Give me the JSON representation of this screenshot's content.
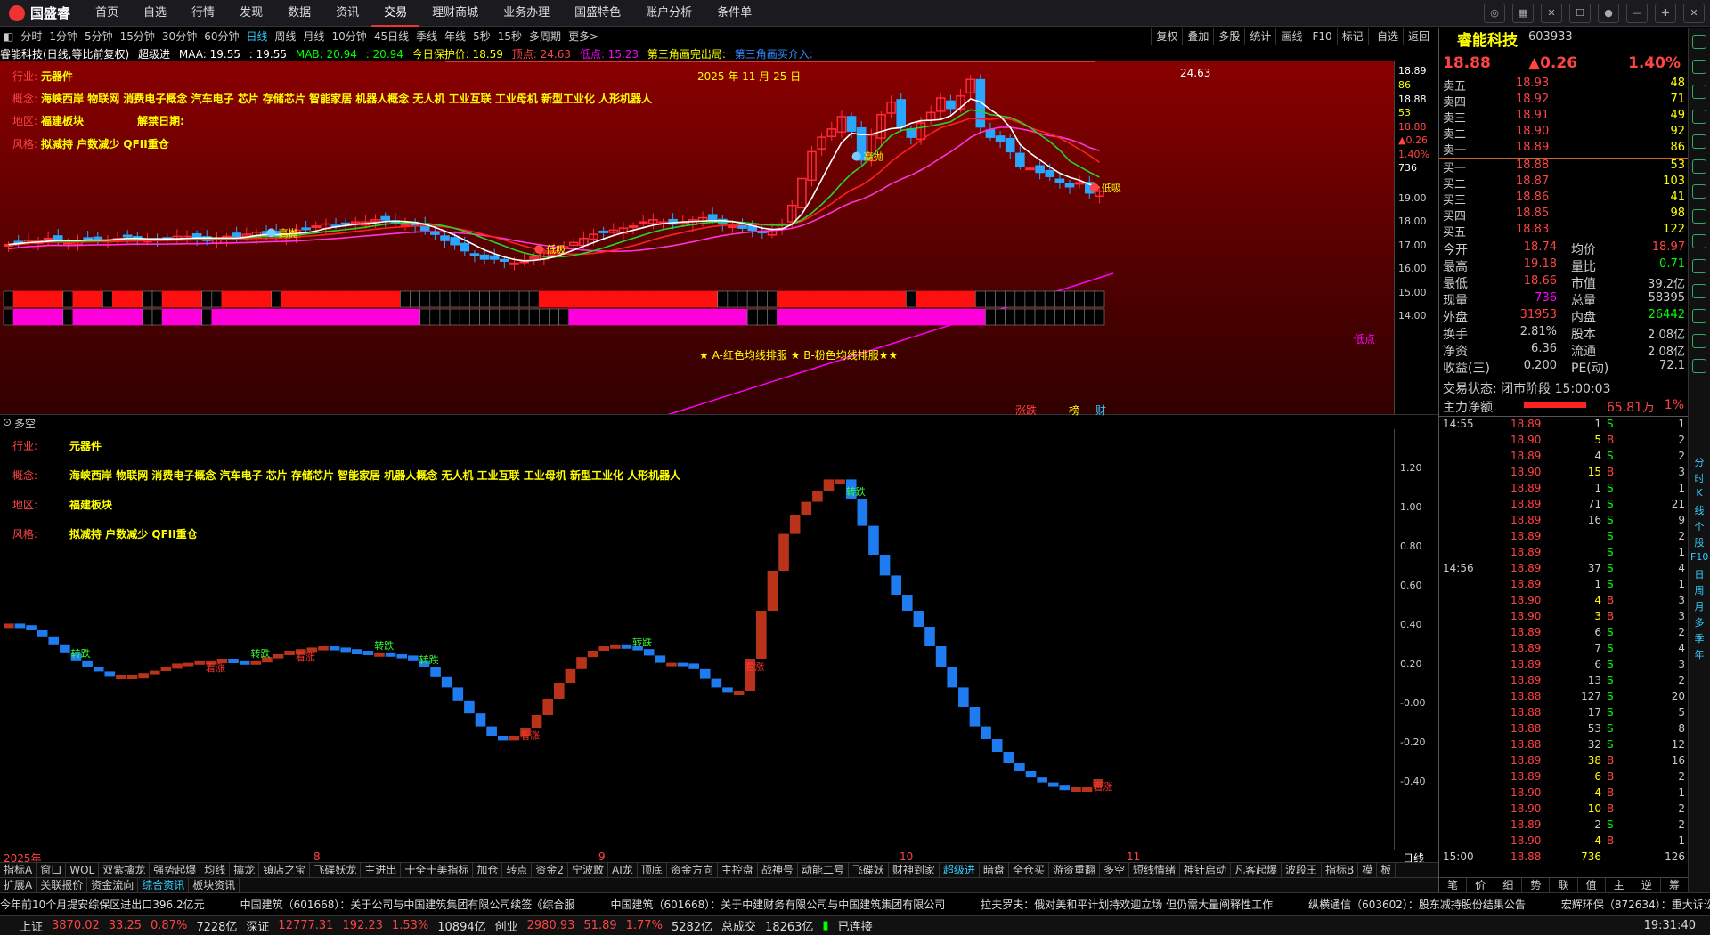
{
  "app": {
    "logo": "国盛睿",
    "menu": [
      "首页",
      "自选",
      "行情",
      "发现",
      "数据",
      "资讯",
      "交易",
      "理财商城",
      "业务办理",
      "国盛特色",
      "账户分析",
      "条件单"
    ],
    "active_menu": "交易"
  },
  "periods": [
    "分时",
    "1分钟",
    "5分钟",
    "15分钟",
    "30分钟",
    "60分钟",
    "日线",
    "周线",
    "月线",
    "10分钟",
    "45日线",
    "季线",
    "年线",
    "5秒",
    "15秒",
    "多周期",
    "更多>"
  ],
  "active_period": "日线",
  "chart_tools": [
    "复权",
    "叠加",
    "多股",
    "统计",
    "画线",
    "F10",
    "标记",
    "-自选",
    "返回"
  ],
  "legend": {
    "name": "睿能科技(日线,等比前复权)",
    "indicator": "超级进",
    "maa_label": "MAA: 19.55",
    "maa_val": ": 19.55",
    "mab_label": "MAB: 20.94",
    "mab_val": ": 20.94",
    "protect": "今日保护价: 18.59",
    "top": "顶点: 24.63",
    "bottom": "低点: 15.23",
    "tri1": "第三角画完出局:",
    "tri2": "第三角画买介入:"
  },
  "info": {
    "industry_k": "行业:",
    "industry_v": "元器件",
    "concept_k": "概念:",
    "concept_v": "海峡西岸 物联网 消费电子概念 汽车电子 芯片 存储芯片 智能家居 机器人概念 无人机 工业互联 工业母机 新型工业化 人形机器人",
    "region_k": "地区:",
    "region_v": "福建板块",
    "lift_k": "解禁日期:",
    "style_k": "风格:",
    "style_v": "拟减持 户数减少 QFII重仓"
  },
  "main_date_label": "2025 年 11 月 25 日",
  "main_top_value": "24.63",
  "main_bottom_label": "低点",
  "ma_note": "★ A-红色均线排服 ★ B-粉色均线排服★★",
  "signal_labels": {
    "high": "高抛",
    "low": "低吸",
    "rise": "看涨",
    "fall": "转跌"
  },
  "main_axis": {
    "ticks": [
      "18.89",
      "86",
      "18.88",
      "53",
      "18.88",
      "▲0.26",
      "1.40%",
      "736",
      "19.00",
      "18.00",
      "17.00",
      "16.00",
      "15.00",
      "14.00"
    ]
  },
  "sub": {
    "title": "多空",
    "bottom_labels": [
      "涨跌",
      "榜",
      "财"
    ]
  },
  "sub_axis": [
    "1.20",
    "1.00",
    "0.80",
    "0.60",
    "0.40",
    "0.20",
    "-0.00",
    "-0.20",
    "-0.40"
  ],
  "dates": [
    "2025年",
    "8",
    "9",
    "10",
    "11"
  ],
  "date_right": "日线",
  "tabs1": [
    "指标A",
    "窗口",
    "WOL",
    "双紫擒龙",
    "强势起爆",
    "均线",
    "擒龙",
    "镇店之宝",
    "飞碟妖龙",
    "主进出",
    "十全十美指标",
    "加仓",
    "转点",
    "资金2",
    "宁波敢",
    "AI龙",
    "顶底",
    "资金方向",
    "主控盘",
    "战神号",
    "动能二号",
    "飞碟妖",
    "财神到家",
    "超级进",
    "暗盘",
    "全仓买",
    "游资重翻",
    "多空",
    "短线情绪",
    "神针启动",
    "凡客起爆",
    "波段王",
    "指标B",
    "模",
    "板"
  ],
  "tabs2": [
    "扩展A",
    "关联报价",
    "资金流向",
    "综合资讯",
    "板块资讯"
  ],
  "news": [
    "今年前10个月提安综保区进出口396.2亿元",
    "中国建筑（601668）：关于公司与中国建筑集团有限公司续签《综合服",
    "中国建筑（601668）：关于中建财务有限公司与中国建筑集团有限公司",
    "拉夫罗夫：俄对美和平计划持欢迎立场 但仍需大量阐释性工作",
    "纵横通信（603602）：股东减持股份结果公告",
    "宏辉环保（872634）：重大诉讼"
  ],
  "status": {
    "sh": "上证",
    "sh_v": "3870.02",
    "sh_c": "33.25",
    "sh_p": "0.87%",
    "sh_a": "7228亿",
    "sz": "深证",
    "sz_v": "12777.31",
    "sz_c": "192.23",
    "sz_p": "1.53%",
    "sz_a": "10894亿",
    "cy": "创业",
    "cy_v": "2980.93",
    "cy_c": "51.89",
    "cy_p": "1.77%",
    "cy_a": "5282亿",
    "tot": "总成交",
    "tot_v": "18263亿",
    "conn": "已连接",
    "time": "19:31:40"
  },
  "quote": {
    "name": "睿能科技",
    "code": "603933",
    "price": "18.88",
    "change": "▲0.26",
    "pct": "1.40%",
    "asks": [
      [
        "卖五",
        "18.93",
        "48"
      ],
      [
        "卖四",
        "18.92",
        "71"
      ],
      [
        "卖三",
        "18.91",
        "49"
      ],
      [
        "卖二",
        "18.90",
        "92"
      ],
      [
        "卖一",
        "18.89",
        "86"
      ]
    ],
    "bids": [
      [
        "买一",
        "18.88",
        "53"
      ],
      [
        "买二",
        "18.87",
        "103"
      ],
      [
        "买三",
        "18.86",
        "41"
      ],
      [
        "买四",
        "18.85",
        "98"
      ],
      [
        "买五",
        "18.83",
        "122"
      ]
    ],
    "stats": [
      [
        "今开",
        "18.74",
        "均价",
        "18.97"
      ],
      [
        "最高",
        "19.18",
        "量比",
        "0.71"
      ],
      [
        "最低",
        "18.66",
        "市值",
        "39.2亿"
      ],
      [
        "现量",
        "736",
        "总量",
        "58395"
      ],
      [
        "外盘",
        "31953",
        "内盘",
        "26442"
      ],
      [
        "换手",
        "2.81%",
        "股本",
        "2.08亿"
      ],
      [
        "净资",
        "6.36",
        "流通",
        "2.08亿"
      ],
      [
        "收益(三)",
        "0.200",
        "PE(动)",
        "72.1"
      ]
    ],
    "trade_state": "交易状态: 闭市阶段 15:00:03",
    "net_label": "主力净额",
    "net_value": "65.81万",
    "net_pct": "1%",
    "ticks": [
      [
        "14:55",
        "18.89",
        "1",
        "S",
        "1"
      ],
      [
        "",
        "18.90",
        "5",
        "B",
        "2"
      ],
      [
        "",
        "18.89",
        "4",
        "S",
        "2"
      ],
      [
        "",
        "18.90",
        "15",
        "B",
        "3"
      ],
      [
        "",
        "18.89",
        "1",
        "S",
        "1"
      ],
      [
        "",
        "18.89",
        "71",
        "S",
        "21"
      ],
      [
        "",
        "18.89",
        "16",
        "S",
        "9"
      ],
      [
        "",
        "18.89",
        "",
        "S",
        "2"
      ],
      [
        "",
        "18.89",
        "",
        "S",
        "1"
      ],
      [
        "14:56",
        "18.89",
        "37",
        "S",
        "4"
      ],
      [
        "",
        "18.89",
        "1",
        "S",
        "1"
      ],
      [
        "",
        "18.90",
        "4",
        "B",
        "3"
      ],
      [
        "",
        "18.90",
        "3",
        "B",
        "3"
      ],
      [
        "",
        "18.89",
        "6",
        "S",
        "2"
      ],
      [
        "",
        "18.89",
        "7",
        "S",
        "4"
      ],
      [
        "",
        "18.89",
        "6",
        "S",
        "3"
      ],
      [
        "",
        "18.89",
        "13",
        "S",
        "2"
      ],
      [
        "",
        "18.88",
        "127",
        "S",
        "20"
      ],
      [
        "",
        "18.88",
        "17",
        "S",
        "5"
      ],
      [
        "",
        "18.88",
        "53",
        "S",
        "8"
      ],
      [
        "",
        "18.88",
        "32",
        "S",
        "12"
      ],
      [
        "",
        "18.89",
        "38",
        "B",
        "16"
      ],
      [
        "",
        "18.89",
        "6",
        "B",
        "2"
      ],
      [
        "",
        "18.90",
        "4",
        "B",
        "1"
      ],
      [
        "",
        "18.90",
        "10",
        "B",
        "2"
      ],
      [
        "",
        "18.89",
        "2",
        "S",
        "2"
      ],
      [
        "",
        "18.90",
        "4",
        "B",
        "1"
      ],
      [
        "15:00",
        "18.88",
        "736",
        "",
        "126"
      ]
    ],
    "bottom_tabs": [
      "笔",
      "价",
      "细",
      "势",
      "联",
      "值",
      "主",
      "逆",
      "筹"
    ]
  },
  "side_icons": [
    "分",
    "时",
    "K",
    "线",
    "个",
    "股",
    "F10",
    "日",
    "周",
    "月",
    "多",
    "季",
    "年"
  ],
  "chart_data": {
    "type": "candlestick",
    "title": "睿能科技(日线,等比前复权)",
    "ylim": [
      14.0,
      25.0
    ],
    "top_price": 24.63,
    "low_price": 15.23,
    "last_close": 18.88,
    "series": [
      {
        "name": "MAA",
        "value": 19.55
      },
      {
        "name": "MAB",
        "value": 20.94
      }
    ],
    "x_labels": [
      "2025年",
      "8",
      "9",
      "10",
      "11"
    ],
    "candles_close": [
      16.3,
      16.4,
      16.5,
      16.5,
      16.6,
      16.5,
      16.4,
      16.5,
      16.6,
      16.6,
      16.5,
      16.6,
      16.7,
      16.6,
      16.5,
      16.5,
      16.6,
      16.7,
      16.7,
      16.6,
      16.5,
      16.6,
      16.7,
      16.7,
      16.8,
      16.9,
      16.8,
      16.7,
      16.8,
      17.0,
      17.1,
      17.2,
      17.3,
      17.2,
      17.3,
      17.4,
      17.4,
      17.5,
      17.5,
      17.4,
      17.3,
      17.2,
      17.0,
      16.8,
      16.5,
      16.3,
      16.0,
      15.8,
      15.6,
      15.6,
      15.5,
      15.4,
      15.5,
      15.7,
      15.9,
      16.0,
      16.2,
      16.4,
      16.6,
      16.8,
      16.9,
      17.0,
      17.1,
      17.2,
      17.4,
      17.5,
      17.4,
      17.3,
      17.4,
      17.5,
      17.6,
      17.5,
      17.3,
      17.2,
      17.1,
      17.0,
      16.9,
      17.0,
      17.3,
      18.2,
      19.5,
      20.8,
      21.5,
      21.9,
      22.5,
      21.8,
      20.4,
      21.6,
      22.6,
      23.2,
      22.0,
      21.5,
      22.2,
      22.7,
      23.4,
      22.9,
      23.5,
      24.3,
      22.0,
      21.5,
      21.3,
      20.8,
      20.1,
      20.0,
      19.8,
      19.6,
      19.3,
      19.1,
      19.3,
      18.8,
      18.88
    ],
    "sub_series": {
      "name": "多空",
      "ylim": [
        -0.6,
        1.4
      ],
      "values": [
        0.42,
        0.41,
        0.38,
        0.34,
        0.29,
        0.24,
        0.19,
        0.15,
        0.12,
        0.1,
        0.1,
        0.1,
        0.11,
        0.13,
        0.15,
        0.17,
        0.18,
        0.19,
        0.19,
        0.2,
        0.19,
        0.18,
        0.19,
        0.21,
        0.23,
        0.25,
        0.26,
        0.27,
        0.28,
        0.27,
        0.26,
        0.25,
        0.24,
        0.24,
        0.23,
        0.22,
        0.19,
        0.15,
        0.09,
        0.02,
        -0.06,
        -0.14,
        -0.22,
        -0.28,
        -0.29,
        -0.28,
        -0.23,
        -0.15,
        -0.05,
        0.05,
        0.14,
        0.21,
        0.25,
        0.28,
        0.29,
        0.28,
        0.26,
        0.22,
        0.18,
        0.18,
        0.17,
        0.14,
        0.08,
        0.02,
        0.0,
        0.0,
        0.2,
        0.5,
        0.75,
        0.98,
        1.1,
        1.18,
        1.25,
        1.32,
        1.32,
        1.2,
        1.03,
        0.85,
        0.72,
        0.6,
        0.5,
        0.4,
        0.28,
        0.15,
        0.02,
        -0.1,
        -0.22,
        -0.3,
        -0.38,
        -0.45,
        -0.5,
        -0.54,
        -0.57,
        -0.59,
        -0.6,
        -0.6,
        -0.6,
        -0.55
      ]
    }
  }
}
